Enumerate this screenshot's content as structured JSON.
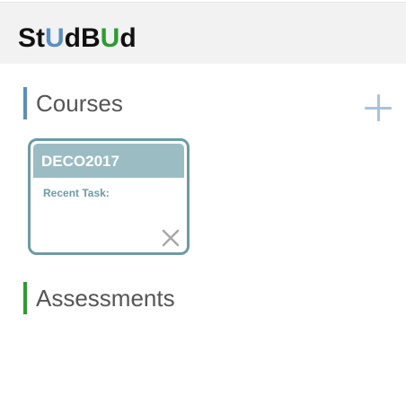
{
  "app": {
    "logo_parts": [
      "St",
      "U",
      "dB",
      "U",
      "d"
    ]
  },
  "sections": {
    "courses": {
      "title": "Courses",
      "add_icon": "plus-icon"
    },
    "assessments": {
      "title": "Assessments"
    }
  },
  "courses": [
    {
      "code": "DECO2017",
      "recent_task_label": "Recent Task:",
      "remove_icon": "close-icon"
    }
  ],
  "colors": {
    "courses_accent": "#5d8fb8",
    "assessments_accent": "#2e9b2e",
    "card_border": "#6e9aa4",
    "card_header": "#9bbcc3",
    "logo_u_blue": "#5b8ec4",
    "logo_u_green": "#2e9b2e"
  }
}
